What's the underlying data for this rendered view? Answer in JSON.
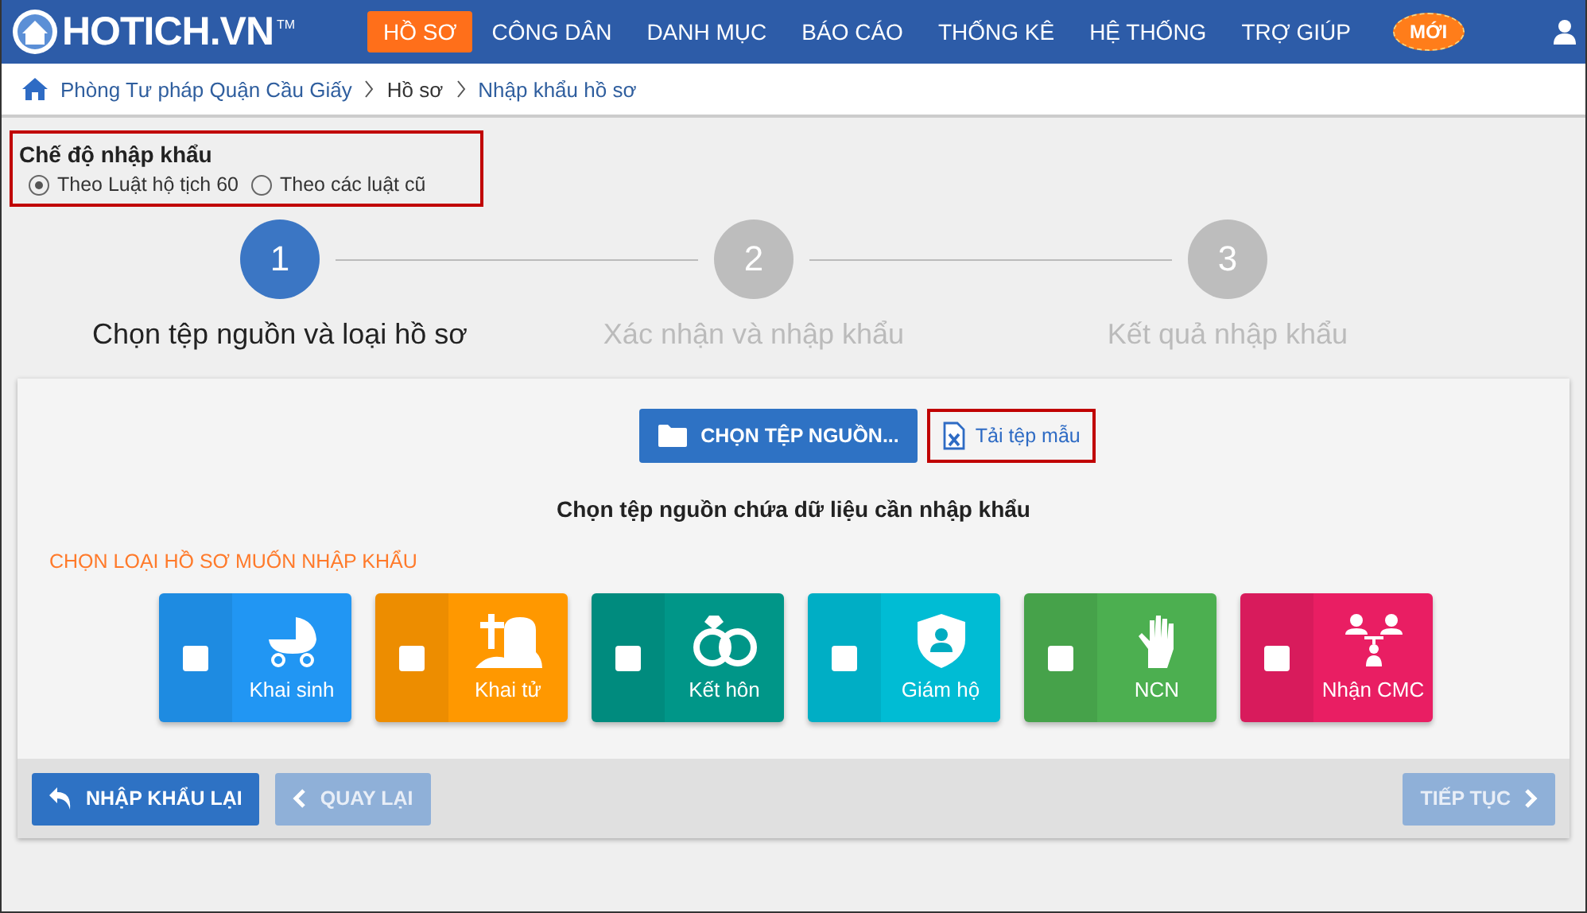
{
  "logo": {
    "text": "HOTICH.VN",
    "mark": "TM"
  },
  "nav": [
    {
      "label": "HỒ SƠ",
      "selected": true
    },
    {
      "label": "CÔNG DÂN",
      "selected": false
    },
    {
      "label": "DANH MỤC",
      "selected": false
    },
    {
      "label": "BÁO CÁO",
      "selected": false
    },
    {
      "label": "THỐNG KÊ",
      "selected": false
    },
    {
      "label": "HỆ THỐNG",
      "selected": false
    },
    {
      "label": "TRỢ GIÚP",
      "selected": false
    }
  ],
  "new_badge": "MỚI",
  "breadcrumb": [
    "Phòng Tư pháp Quận Cầu Giấy",
    "Hồ sơ",
    "Nhập khẩu hồ sơ"
  ],
  "mode": {
    "title": "Chế độ nhập khẩu",
    "options": [
      {
        "label": "Theo Luật hộ tịch 60",
        "selected": true
      },
      {
        "label": "Theo các luật cũ",
        "selected": false
      }
    ]
  },
  "steps": [
    {
      "number": "1",
      "label": "Chọn tệp nguồn và loại hồ sơ",
      "active": true
    },
    {
      "number": "2",
      "label": "Xác nhận và nhập khẩu",
      "active": false
    },
    {
      "number": "3",
      "label": "Kết quả nhập khẩu",
      "active": false
    }
  ],
  "choose_button": "CHỌN TỆP NGUỒN...",
  "template_link": "Tải tệp mẫu",
  "hint": "Chọn tệp nguồn chứa dữ liệu cần nhập khẩu",
  "section_title": "CHỌN LOẠI HỒ SƠ MUỐN NHẬP KHẨU",
  "types": [
    {
      "kind": "birth",
      "label": "Khai sinh",
      "checked": false,
      "color": "#2196f3"
    },
    {
      "kind": "death",
      "label": "Khai tử",
      "checked": false,
      "color": "#ff9800"
    },
    {
      "kind": "marriage",
      "label": "Kết hôn",
      "checked": false,
      "color": "#009688"
    },
    {
      "kind": "guardian",
      "label": "Giám hộ",
      "checked": false,
      "color": "#00bcd4"
    },
    {
      "kind": "hand",
      "label": "NCN",
      "checked": false,
      "color": "#4caf50"
    },
    {
      "kind": "family",
      "label": "Nhận CMC",
      "checked": false,
      "color": "#e91e63"
    }
  ],
  "footer": [
    {
      "kind": "back",
      "label": "NHẬP KHẨU LẠI",
      "disabled": false
    },
    {
      "kind": "prev",
      "label": "QUAY LẠI",
      "disabled": true
    },
    {
      "kind": "next",
      "label": "TIẾP TỤC",
      "disabled": true
    }
  ]
}
